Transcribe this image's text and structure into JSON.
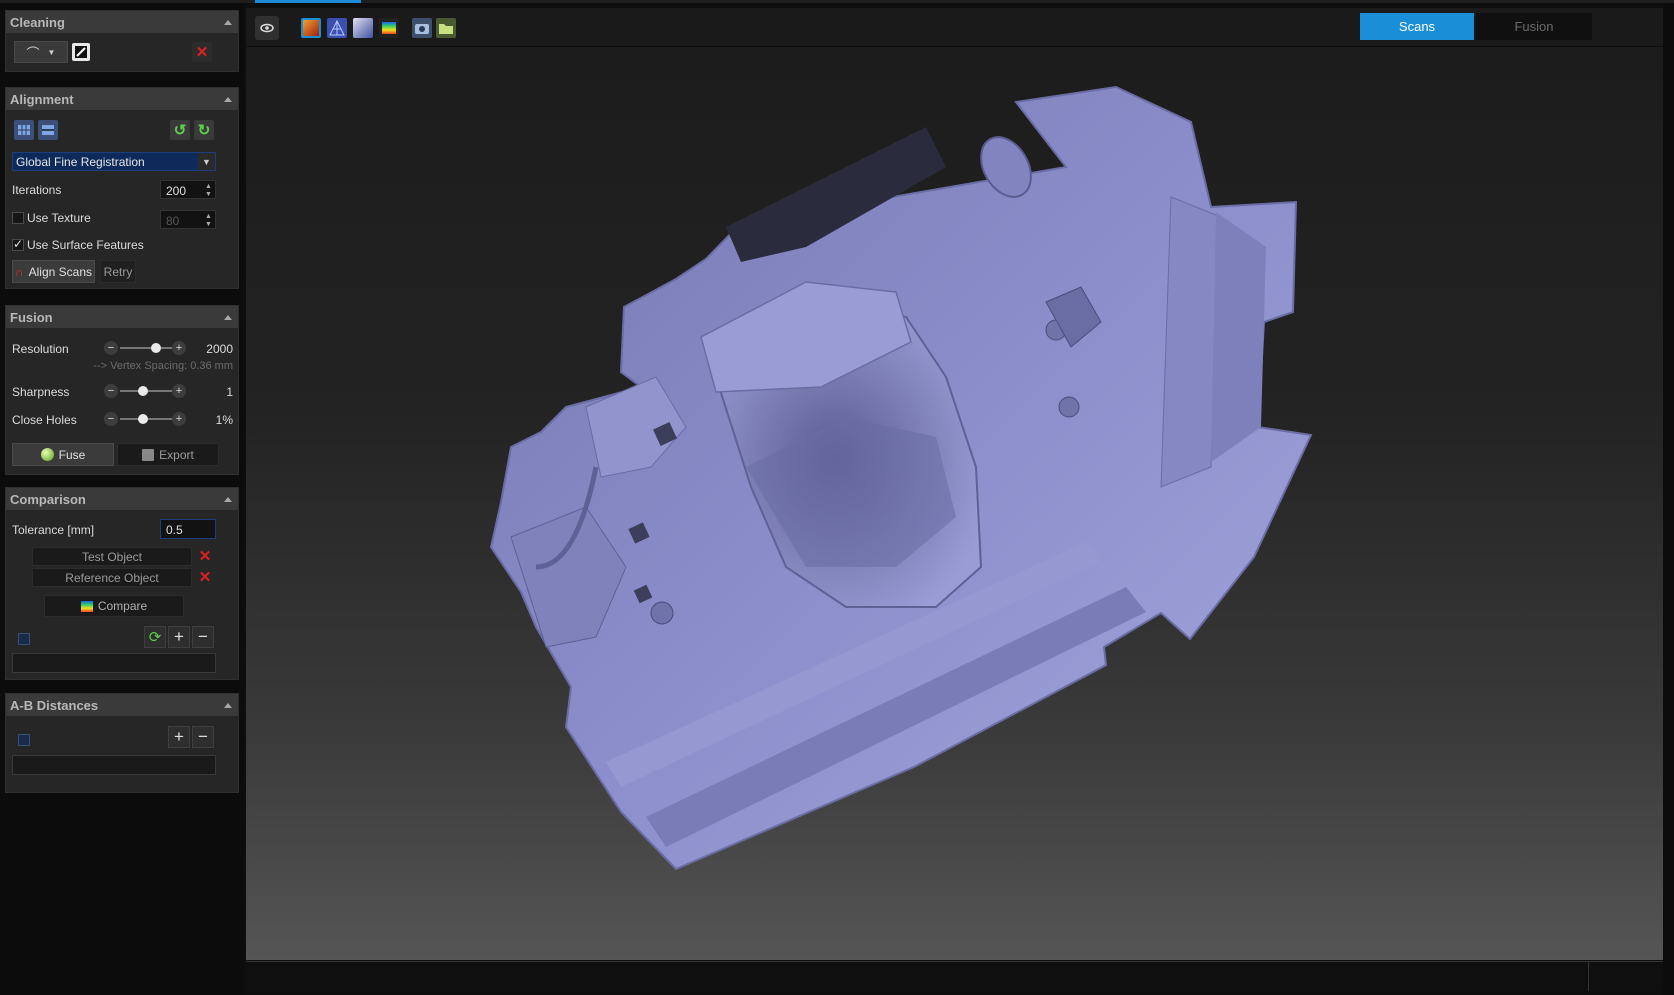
{
  "cleaning": {
    "title": "Cleaning"
  },
  "alignment": {
    "title": "Alignment",
    "method": "Global Fine Registration",
    "iterations_label": "Iterations",
    "iterations_value": "200",
    "use_texture_label": "Use Texture",
    "use_texture_checked": false,
    "texture_value": "80",
    "use_surface_label": "Use Surface Features",
    "use_surface_checked": true,
    "align_button": "Align Scans",
    "retry_button": "Retry"
  },
  "fusion": {
    "title": "Fusion",
    "resolution_label": "Resolution",
    "resolution_value": "2000",
    "resolution_level": 0.7,
    "vertex_spacing": "--> Vertex Spacing: 0.36 mm",
    "sharpness_label": "Sharpness",
    "sharpness_value": "1",
    "sharpness_level": 0.45,
    "close_holes_label": "Close Holes",
    "close_holes_value": "1%",
    "close_holes_level": 0.45,
    "fuse_button": "Fuse",
    "export_button": "Export"
  },
  "comparison": {
    "title": "Comparison",
    "tolerance_label": "Tolerance [mm]",
    "tolerance_value": "0.5",
    "test_object": "Test Object",
    "reference_object": "Reference Object",
    "compare_button": "Compare"
  },
  "ab_distances": {
    "title": "A-B Distances"
  },
  "view_tabs": {
    "scans": "Scans",
    "fusion": "Fusion",
    "active": "Scans"
  },
  "colors": {
    "accent": "#1a8fd8",
    "mesh": "#8a8cc8",
    "delete": "#e02020",
    "confirm": "#3aa84a"
  },
  "icons": [
    "eye-icon",
    "texture-icon",
    "wireframe-icon",
    "shading-icon",
    "colormap-icon",
    "screenshot-icon",
    "open-folder-icon",
    "lasso-icon",
    "invert-selection-icon",
    "delete-icon",
    "undo-icon",
    "redo-icon",
    "magnet-icon",
    "sphere-icon",
    "save-icon",
    "refresh-icon",
    "plus-icon",
    "minus-icon"
  ]
}
